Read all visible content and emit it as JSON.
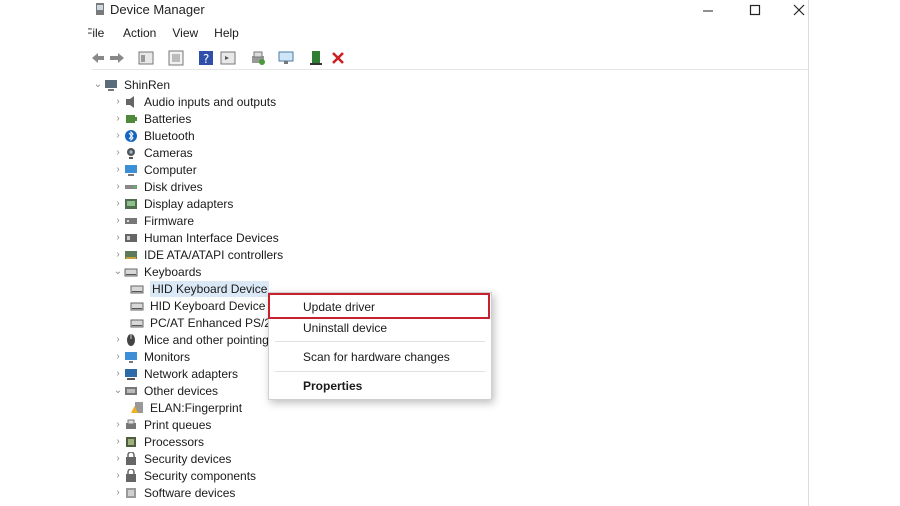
{
  "window": {
    "title": "Device Manager"
  },
  "menubar": [
    "File",
    "Action",
    "View",
    "Help"
  ],
  "tree": {
    "root": "ShinRen",
    "items": [
      {
        "label": "Audio inputs and outputs",
        "icon": "speaker-icon"
      },
      {
        "label": "Batteries",
        "icon": "battery-icon"
      },
      {
        "label": "Bluetooth",
        "icon": "bluetooth-icon"
      },
      {
        "label": "Cameras",
        "icon": "camera-icon"
      },
      {
        "label": "Computer",
        "icon": "computer-icon"
      },
      {
        "label": "Disk drives",
        "icon": "disk-icon"
      },
      {
        "label": "Display adapters",
        "icon": "display-adapter-icon"
      },
      {
        "label": "Firmware",
        "icon": "firmware-icon"
      },
      {
        "label": "Human Interface Devices",
        "icon": "hid-icon"
      },
      {
        "label": "IDE ATA/ATAPI controllers",
        "icon": "ide-icon"
      },
      {
        "label": "Keyboards",
        "icon": "keyboard-icon"
      },
      {
        "label": "HID Keyboard Device",
        "icon": "keyboard-icon"
      },
      {
        "label": "HID Keyboard Device",
        "icon": "keyboard-icon"
      },
      {
        "label": "PC/AT Enhanced PS/2",
        "icon": "keyboard-icon"
      },
      {
        "label": "Mice and other pointing",
        "icon": "mouse-icon"
      },
      {
        "label": "Monitors",
        "icon": "monitor-icon"
      },
      {
        "label": "Network adapters",
        "icon": "network-icon"
      },
      {
        "label": "Other devices",
        "icon": "other-devices-icon"
      },
      {
        "label": "ELAN:Fingerprint",
        "icon": "warning-icon"
      },
      {
        "label": "Print queues",
        "icon": "printer-icon"
      },
      {
        "label": "Processors",
        "icon": "processor-icon"
      },
      {
        "label": "Security devices",
        "icon": "security-icon"
      },
      {
        "label": "Security components",
        "icon": "security-icon"
      },
      {
        "label": "Software devices",
        "icon": "software-icon"
      }
    ]
  },
  "context_menu": {
    "update": "Update driver",
    "uninstall": "Uninstall device",
    "scan": "Scan for hardware changes",
    "properties": "Properties"
  },
  "colors": {
    "highlight_border": "#c8202e",
    "selection": "#dbe9f6"
  }
}
